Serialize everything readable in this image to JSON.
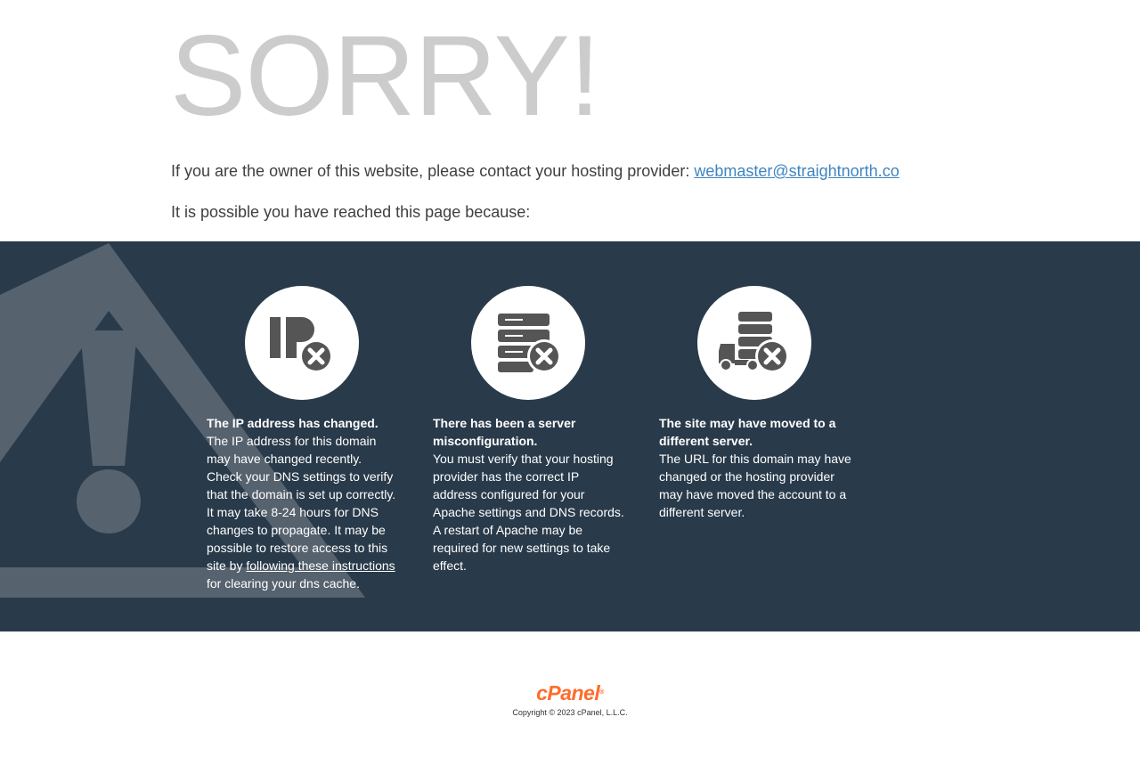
{
  "heading": "SORRY!",
  "contact": {
    "text": "If you are the owner of this website, please contact your hosting provider: ",
    "email": "webmaster@straightnorth.co"
  },
  "reason_intro": "It is possible you have reached this page because:",
  "cards": [
    {
      "icon": "ip-error-icon",
      "title": "The IP address has changed.",
      "body_before_link": "The IP address for this domain may have changed recently. Check your DNS settings to verify that the domain is set up correctly. It may take 8-24 hours for DNS changes to propagate. It may be possible to restore access to this site by ",
      "link": "following these instructions",
      "body_after_link": " for clearing your dns cache."
    },
    {
      "icon": "server-error-icon",
      "title": "There has been a server misconfiguration.",
      "body": "You must verify that your hosting provider has the correct IP address configured for your Apache settings and DNS records. A restart of Apache may be required for new settings to take effect."
    },
    {
      "icon": "server-moved-icon",
      "title": "The site may have moved to a different server.",
      "body": "The URL for this domain may have changed or the hosting provider may have moved the account to a different server."
    }
  ],
  "footer": {
    "logo": "cPanel",
    "logo_mark": "®",
    "copyright": "Copyright © 2023 cPanel, L.L.C."
  },
  "colors": {
    "band": "#293a4a",
    "heading": "#cccccc",
    "link": "#3e84c0",
    "brand": "#ff6c2c"
  }
}
